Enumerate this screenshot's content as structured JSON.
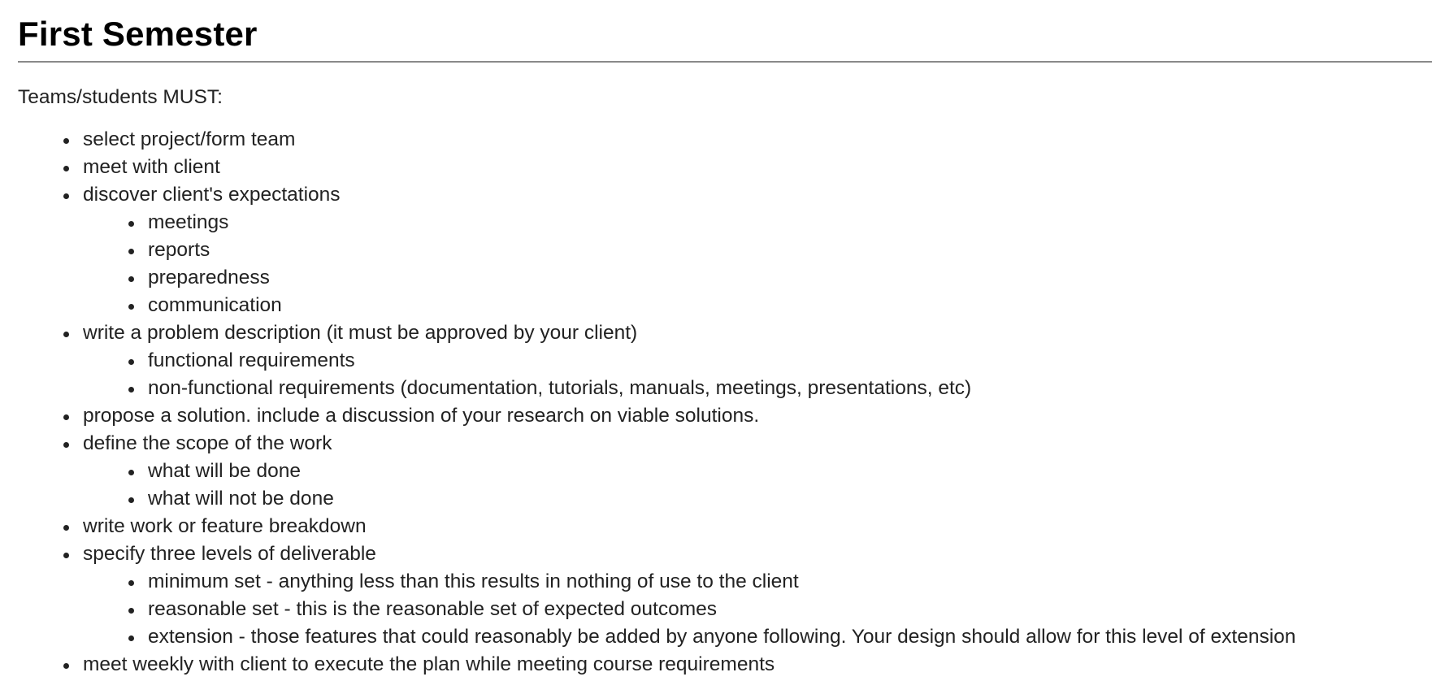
{
  "title": "First Semester",
  "intro": "Teams/students MUST:",
  "items": [
    {
      "text": "select project/form team"
    },
    {
      "text": "meet with client"
    },
    {
      "text": "discover client's expectations",
      "sub": [
        "meetings",
        "reports",
        "preparedness",
        "communication"
      ]
    },
    {
      "text": "write a problem description  (it must be approved by your client)",
      "sub": [
        "functional requirements",
        "non-functional requirements (documentation, tutorials, manuals, meetings, presentations, etc)"
      ]
    },
    {
      "text": "propose a solution.  include a discussion of your research on viable solutions."
    },
    {
      "text": "define the scope of the work",
      "sub": [
        "what will be done",
        "what will not be done"
      ]
    },
    {
      "text": "write work or feature breakdown"
    },
    {
      "text": "specify three levels of deliverable",
      "sub": [
        "minimum set - anything less than this results in nothing of use to the client",
        "reasonable set - this is the reasonable set of expected outcomes",
        "extension - those features that could reasonably be added by anyone following.  Your design should allow for this level of extension"
      ]
    },
    {
      "text": "meet weekly with client to execute the plan while meeting course requirements"
    }
  ]
}
